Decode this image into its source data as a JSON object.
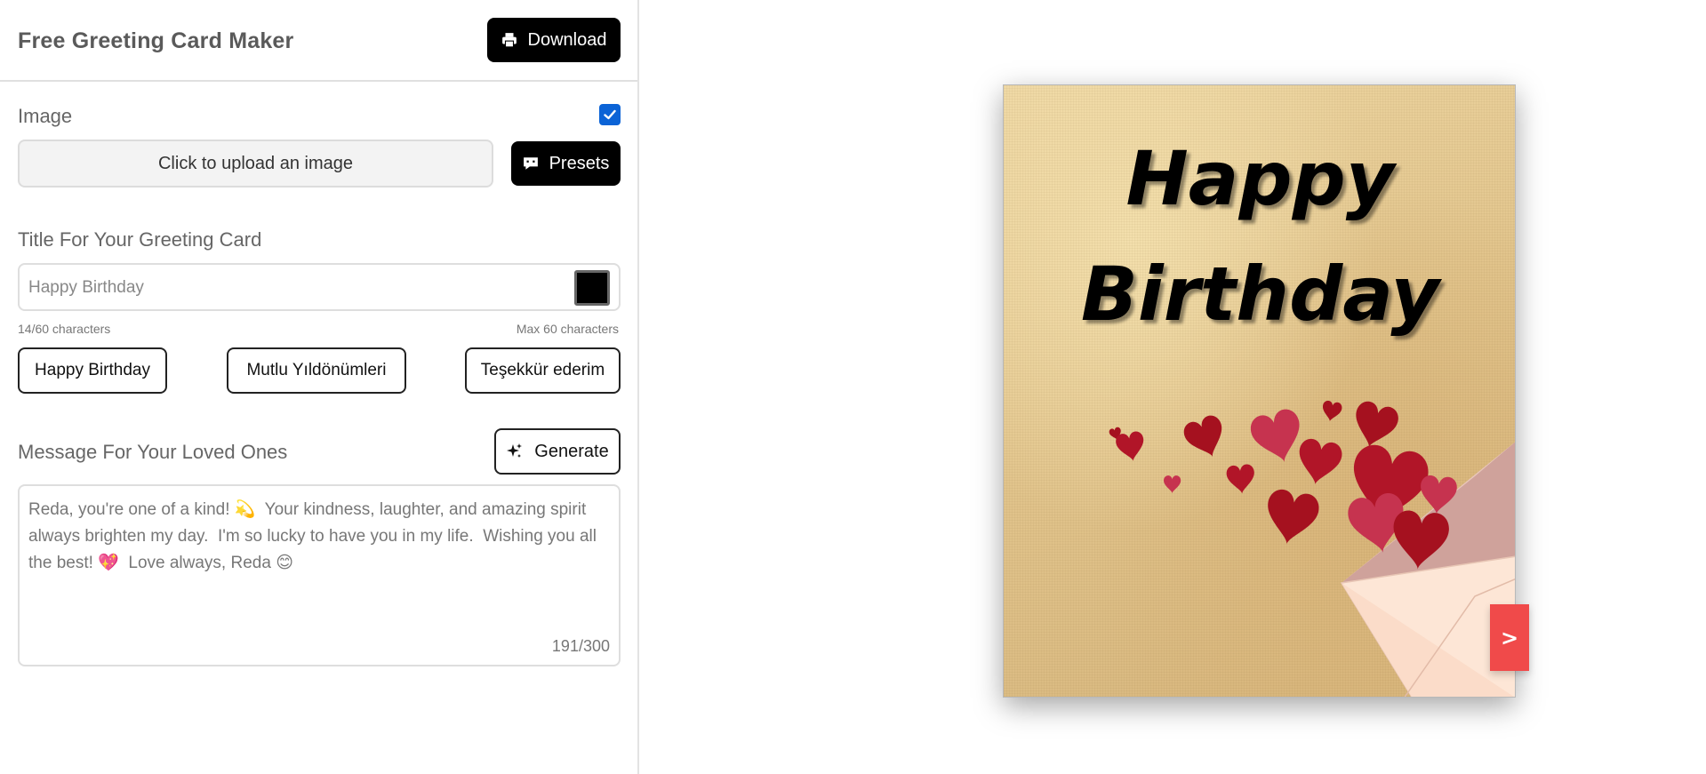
{
  "app": {
    "title": "Free Greeting Card Maker"
  },
  "toolbar": {
    "download_label": "Download",
    "download_icon": "printer-icon"
  },
  "image_section": {
    "label": "Image",
    "enabled": true,
    "upload_label": "Click to upload an image",
    "presets_label": "Presets",
    "presets_icon": "chat-icon"
  },
  "title_section": {
    "label": "Title For Your Greeting Card",
    "value": "Happy Birthday",
    "color": "#000000",
    "count_text": "14/60 characters",
    "max_text": "Max 60 characters",
    "presets": [
      "Happy Birthday",
      "Mutlu Yıldönümleri",
      "Teşekkür ederim"
    ]
  },
  "message_section": {
    "label": "Message For Your Loved Ones",
    "generate_label": "Generate",
    "generate_icon": "sparkle-icon",
    "text": "Reda, you're one of a kind! 💫  Your kindness, laughter, and amazing spirit always brighten my day.  I'm so lucky to have you in my life.  Wishing you all the best! 💖  Love always, Reda 😊",
    "count": "191/300"
  },
  "preview": {
    "card_title": "Happy Birthday",
    "next_label": ">",
    "colors": {
      "paper": "#e2c58d",
      "heart_dark": "#a5111f",
      "heart_light": "#c6334f",
      "envelope": "#fde6d6",
      "next_button": "#f04a4a"
    }
  }
}
